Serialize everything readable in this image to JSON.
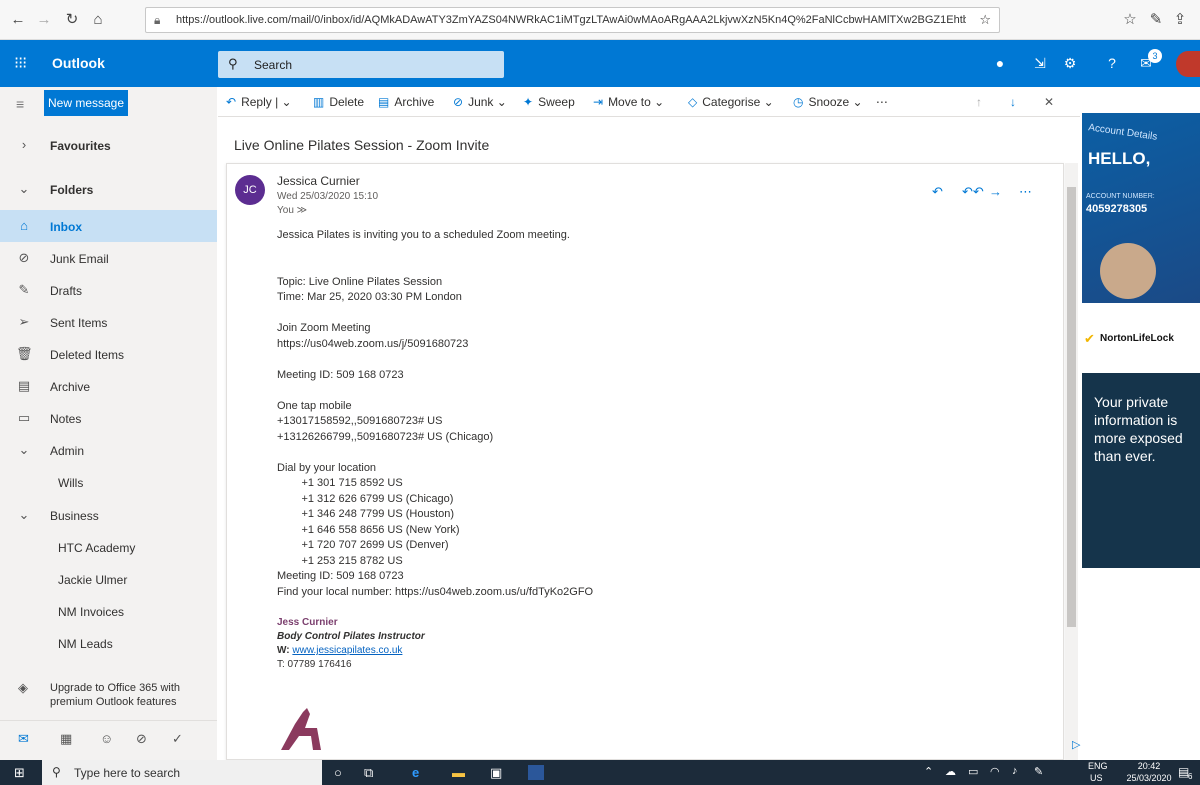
{
  "browser": {
    "url": "https://outlook.live.com/mail/0/inbox/id/AQMkADAwATY3ZmYAZS04NWRkAC1iMTgzLTAwAi0wMAoARgAAA2LkjvwXzN5Kn4Q%2FaNlCcbwHAMlTXw2BGZ1EhtbyRrysC5kAAAIBDAAA"
  },
  "header": {
    "app_name": "Outlook",
    "search_placeholder": "Search",
    "badge": "3"
  },
  "nav": {
    "new_message": "New message",
    "items": [
      {
        "label": "Favourites",
        "icon": "chevron-right-icon",
        "glyph": "›"
      },
      {
        "label": "Folders",
        "icon": "chevron-down-icon",
        "glyph": "⌄"
      },
      {
        "label": "Inbox",
        "icon": "inbox-icon",
        "glyph": "⌂"
      },
      {
        "label": "Junk Email",
        "icon": "block-icon",
        "glyph": "⊘"
      },
      {
        "label": "Drafts",
        "icon": "pencil-icon",
        "glyph": "✎"
      },
      {
        "label": "Sent Items",
        "icon": "send-icon",
        "glyph": "➢"
      },
      {
        "label": "Deleted Items",
        "icon": "trash-icon",
        "glyph": "🗑"
      },
      {
        "label": "Archive",
        "icon": "archive-icon",
        "glyph": "▤"
      },
      {
        "label": "Notes",
        "icon": "note-icon",
        "glyph": "▭"
      },
      {
        "label": "Admin",
        "icon": "chevron-down-icon",
        "glyph": "⌄"
      },
      {
        "label": "Wills",
        "icon": "",
        "glyph": ""
      },
      {
        "label": "Business",
        "icon": "chevron-down-icon",
        "glyph": "⌄"
      },
      {
        "label": "HTC Academy",
        "icon": "",
        "glyph": ""
      },
      {
        "label": "Jackie Ulmer",
        "icon": "",
        "glyph": ""
      },
      {
        "label": "NM Invoices",
        "icon": "",
        "glyph": ""
      },
      {
        "label": "NM Leads",
        "icon": "",
        "glyph": ""
      }
    ],
    "upgrade_line1": "Upgrade to Office 365 with",
    "upgrade_line2": "premium Outlook features"
  },
  "toolbar": {
    "reply": "Reply",
    "delete": "Delete",
    "archive": "Archive",
    "junk": "Junk",
    "sweep": "Sweep",
    "move_to": "Move to",
    "categorise": "Categorise",
    "snooze": "Snooze"
  },
  "message": {
    "subject": "Live Online Pilates Session - Zoom Invite",
    "initials": "JC",
    "sender": "Jessica Curnier",
    "date": "Wed 25/03/2020 15:10",
    "to": "You ≫",
    "body": [
      "Jessica Pilates is inviting you to a scheduled Zoom meeting.",
      "",
      "",
      "Topic: Live Online Pilates Session",
      "Time: Mar 25, 2020 03:30 PM London",
      "",
      "Join Zoom Meeting",
      "https://us04web.zoom.us/j/5091680723",
      "",
      "Meeting ID: 509 168 0723",
      "",
      "One tap mobile",
      "+13017158592,,5091680723# US",
      "+13126266799,,5091680723# US (Chicago)",
      "",
      "Dial by your location",
      "        +1 301 715 8592 US",
      "        +1 312 626 6799 US (Chicago)",
      "        +1 346 248 7799 US (Houston)",
      "        +1 646 558 8656 US (New York)",
      "        +1 720 707 2699 US (Denver)",
      "        +1 253 215 8782 US",
      "Meeting ID: 509 168 0723",
      "Find your local number: https://us04web.zoom.us/u/fdTyKo2GFO"
    ],
    "sig_name": "Jess Curnier",
    "sig_title": "Body Control Pilates Instructor",
    "sig_w_label": "W:",
    "sig_web": "www.jessicapilates.co.uk",
    "sig_phone": "T: 07789 176416"
  },
  "ad": {
    "account_details": "Account Details",
    "hello": "HELLO,",
    "account_number_label": "ACCOUNT NUMBER:",
    "account_number": "4059278305",
    "brand": "NortonLifeLock",
    "text": "Your private information is more exposed than ever."
  },
  "taskbar": {
    "search_placeholder": "Type here to search",
    "lang_line1": "ENG",
    "lang_line2": "US",
    "time": "20:42",
    "date": "25/03/2020",
    "notif_count": "6"
  }
}
